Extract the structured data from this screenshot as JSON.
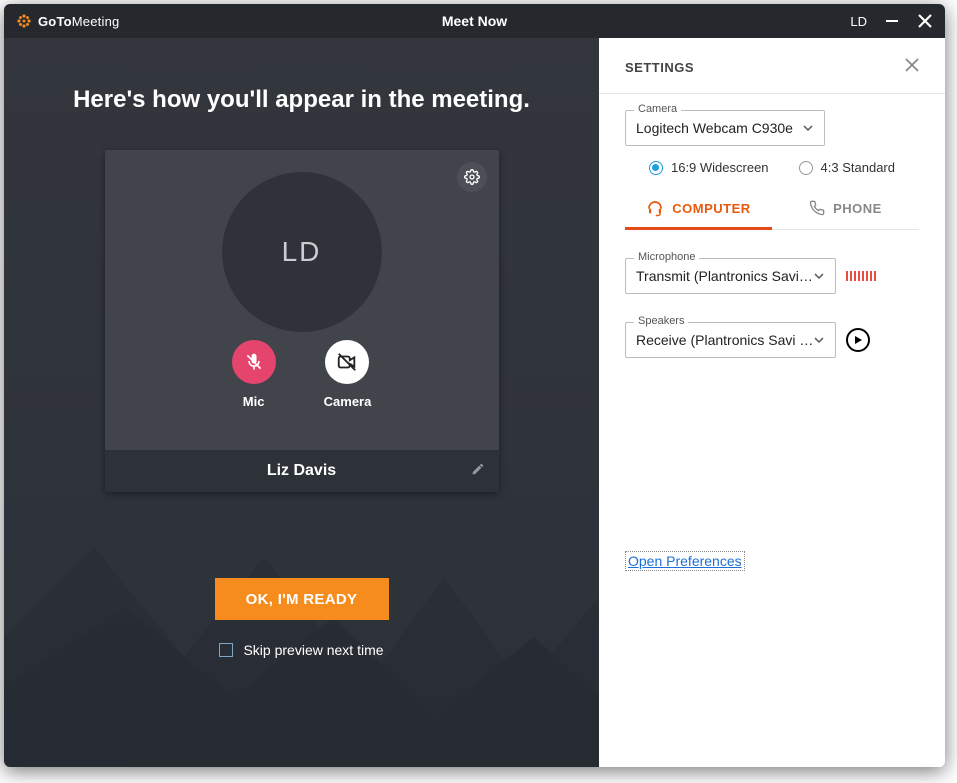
{
  "titlebar": {
    "brand_bold": "GoTo",
    "brand_light": "Meeting",
    "title": "Meet Now",
    "user_initials": "LD"
  },
  "preview": {
    "heading": "Here's how you'll appear in the meeting.",
    "avatar_initials": "LD",
    "mic_label": "Mic",
    "camera_label": "Camera",
    "display_name": "Liz Davis",
    "ready_button": "OK, I'M READY",
    "skip_label": "Skip preview next time",
    "skip_checked": false
  },
  "settings": {
    "title": "SETTINGS",
    "camera": {
      "legend": "Camera",
      "value": "Logitech Webcam C930e"
    },
    "aspect": {
      "widescreen_label": "16:9 Widescreen",
      "standard_label": "4:3 Standard",
      "selected": "widescreen"
    },
    "audio_tabs": {
      "computer": "COMPUTER",
      "phone": "PHONE",
      "active": "computer"
    },
    "microphone": {
      "legend": "Microphone",
      "value": "Transmit (Plantronics Savi…"
    },
    "speakers": {
      "legend": "Speakers",
      "value": "Receive (Plantronics Savi …"
    },
    "preferences_link": "Open Preferences"
  }
}
